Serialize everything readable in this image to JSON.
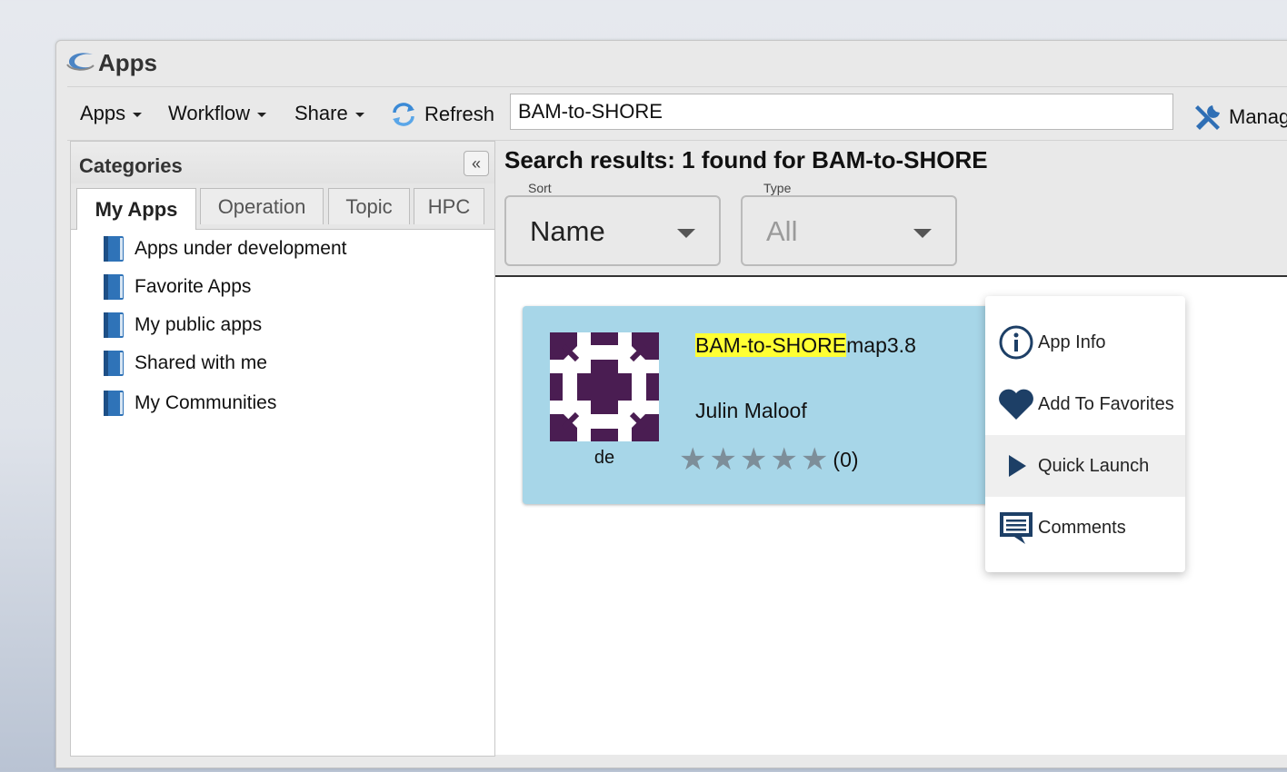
{
  "window": {
    "title": "Apps"
  },
  "toolbar": {
    "apps_label": "Apps",
    "workflow_label": "Workflow",
    "share_label": "Share",
    "refresh_label": "Refresh",
    "search_value": "BAM-to-SHORE",
    "manage_label": "Manag"
  },
  "categories": {
    "title": "Categories",
    "tabs": [
      {
        "label": "My Apps",
        "active": true
      },
      {
        "label": "Operation",
        "active": false
      },
      {
        "label": "Topic",
        "active": false
      },
      {
        "label": "HPC",
        "active": false
      }
    ],
    "items": [
      {
        "label": "Apps under development",
        "icon": "book-icon"
      },
      {
        "label": "Favorite Apps",
        "icon": "book-icon"
      },
      {
        "label": "My public apps",
        "icon": "book-icon"
      },
      {
        "label": "Shared with me",
        "icon": "book-icon"
      },
      {
        "label": "My Communities",
        "icon": "book-icon"
      }
    ]
  },
  "results": {
    "title": "Search results: 1 found for BAM-to-SHORE",
    "sort": {
      "label": "Sort",
      "value": "Name"
    },
    "type": {
      "label": "Type",
      "value": "All"
    }
  },
  "app_card": {
    "name_highlight": "BAM-to-SHORE",
    "name_rest": "map3.8",
    "author": "Julin Maloof",
    "icon_label": "de",
    "rating_stars": 5,
    "rating_count": "(0)",
    "bg_color": "#a7d6e8",
    "icon_color": "#4a1d52"
  },
  "context_menu": {
    "items": [
      {
        "label": "App Info",
        "icon": "info-icon"
      },
      {
        "label": "Add To Favorites",
        "icon": "heart-icon"
      },
      {
        "label": "Quick Launch",
        "icon": "play-icon",
        "hovered": true
      },
      {
        "label": "Comments",
        "icon": "comment-icon"
      }
    ],
    "icon_color": "#1d3f66"
  }
}
